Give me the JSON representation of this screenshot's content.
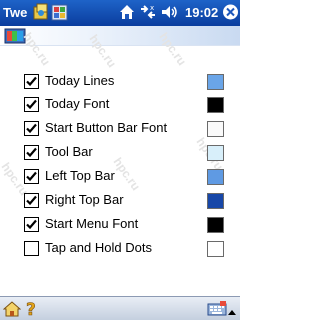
{
  "taskbar": {
    "app_title": "Twe",
    "time": "19:02",
    "icons": [
      "program-icon",
      "app-icon",
      "home-icon",
      "connectivity-icon",
      "volume-icon",
      "close-icon"
    ]
  },
  "header": {
    "logo_icon": "colored-blocks-logo"
  },
  "watermark": "hpc.ru",
  "settings": [
    {
      "label": "Today Lines",
      "checked": true,
      "color": "#6aa5e8"
    },
    {
      "label": "Today Font",
      "checked": true,
      "color": "#000000"
    },
    {
      "label": "Start Button Bar Font",
      "checked": true,
      "color": "#fafafa"
    },
    {
      "label": "Tool Bar",
      "checked": true,
      "color": "#d8effa"
    },
    {
      "label": "Left Top Bar",
      "checked": true,
      "color": "#5f9ae3"
    },
    {
      "label": "Right Top Bar",
      "checked": true,
      "color": "#1747a8"
    },
    {
      "label": "Start Menu Font",
      "checked": true,
      "color": "#000000"
    },
    {
      "label": "Tap and Hold Dots",
      "checked": false,
      "color": "#ffffff"
    }
  ],
  "bottombar": {
    "icons": [
      "home-icon",
      "help-icon",
      "keyboard-icon",
      "input-menu-arrow-icon"
    ]
  }
}
